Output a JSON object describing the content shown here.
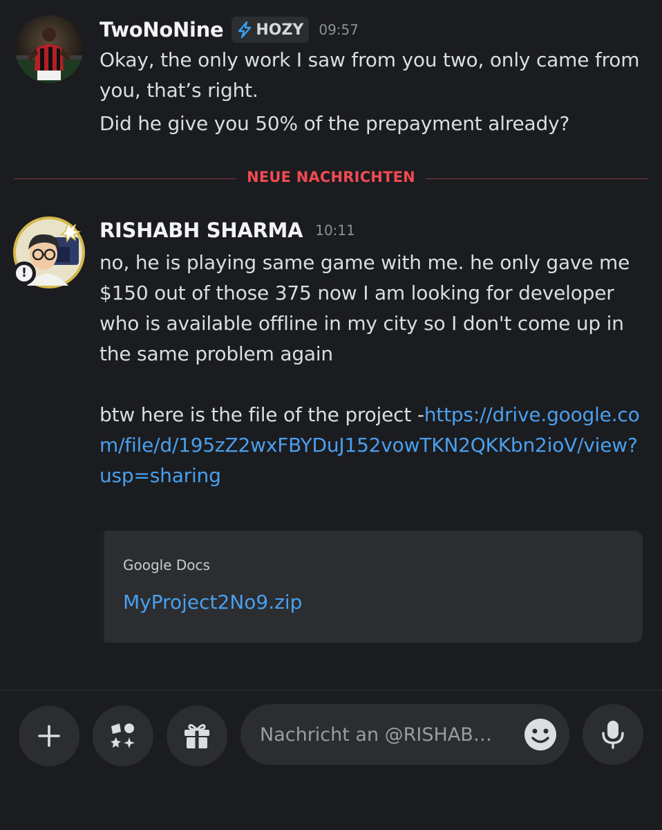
{
  "messages": [
    {
      "username": "TwoNoNine",
      "tag": {
        "icon": "lightning-icon",
        "label": "HOZY"
      },
      "timestamp": "09:57",
      "lines": [
        "Okay, the only work I saw from you two, only came from you, that’s right.",
        "Did he give you 50% of the prepayment already?"
      ]
    },
    {
      "username": "RISHABH SHARMA",
      "timestamp": "10:11",
      "text": "no, he is playing same game with me. he only gave me $150 out of those 375 now I am looking for developer who is available offline in my city so I don't come up in the same problem again",
      "link_prefix": "btw here is the file of the project -",
      "link_url": "https://drive.google.com/file/d/195zZ2wxFBYDuJ152vowTKN2QKKbn2ioV/view?usp=sharing",
      "status_badge": "!",
      "embed": {
        "provider": "Google Docs",
        "title": "MyProject2No9.zip"
      }
    }
  ],
  "divider": {
    "label": "NEUE NACHRICHTEN",
    "color": "#f04b52"
  },
  "composer": {
    "placeholder": "Nachricht an @RISHAB…",
    "buttons": [
      "plus-icon",
      "apps-icon",
      "gift-icon",
      "emoji-icon",
      "microphone-icon"
    ]
  },
  "colors": {
    "background": "#1b1c20",
    "surface": "#2b2d31",
    "link": "#4aa0ee",
    "tag_icon": "#3aa0f0"
  }
}
